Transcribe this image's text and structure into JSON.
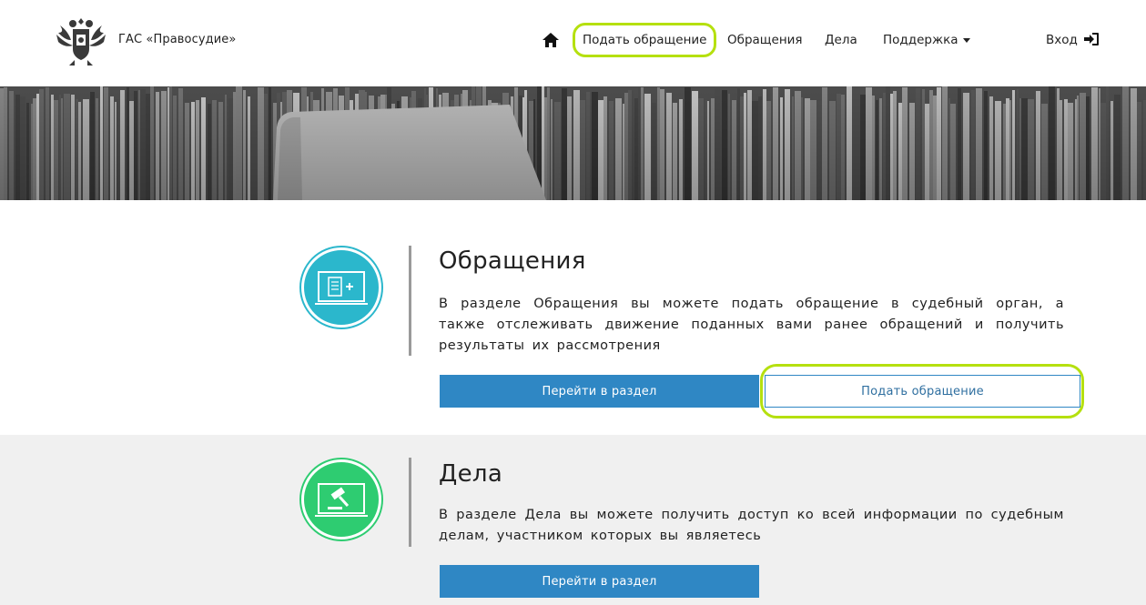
{
  "header": {
    "brand": "ГАС «Правосудие»",
    "nav": {
      "submit": "Подать обращение",
      "appeals": "Обращения",
      "cases": "Дела",
      "support": "Поддержка",
      "login": "Вход"
    }
  },
  "sections": {
    "appeals": {
      "title": "Обращения",
      "description": "В разделе Обращения вы можете подать обращение в судебный орган, а также отслеживать движение поданных вами ранее обращений и получить результаты их рассмотрения",
      "go_button": "Перейти в раздел",
      "submit_button": "Подать обращение",
      "accent": "#2bb7cc"
    },
    "cases": {
      "title": "Дела",
      "description": "В разделе Дела вы можете получить доступ ко всей информации по судебным делам, участником которых вы являетесь",
      "go_button": "Перейти в раздел",
      "accent": "#2ecc71"
    }
  },
  "colors": {
    "primary_button": "#2f87c4",
    "highlight": "#b5e00f"
  }
}
